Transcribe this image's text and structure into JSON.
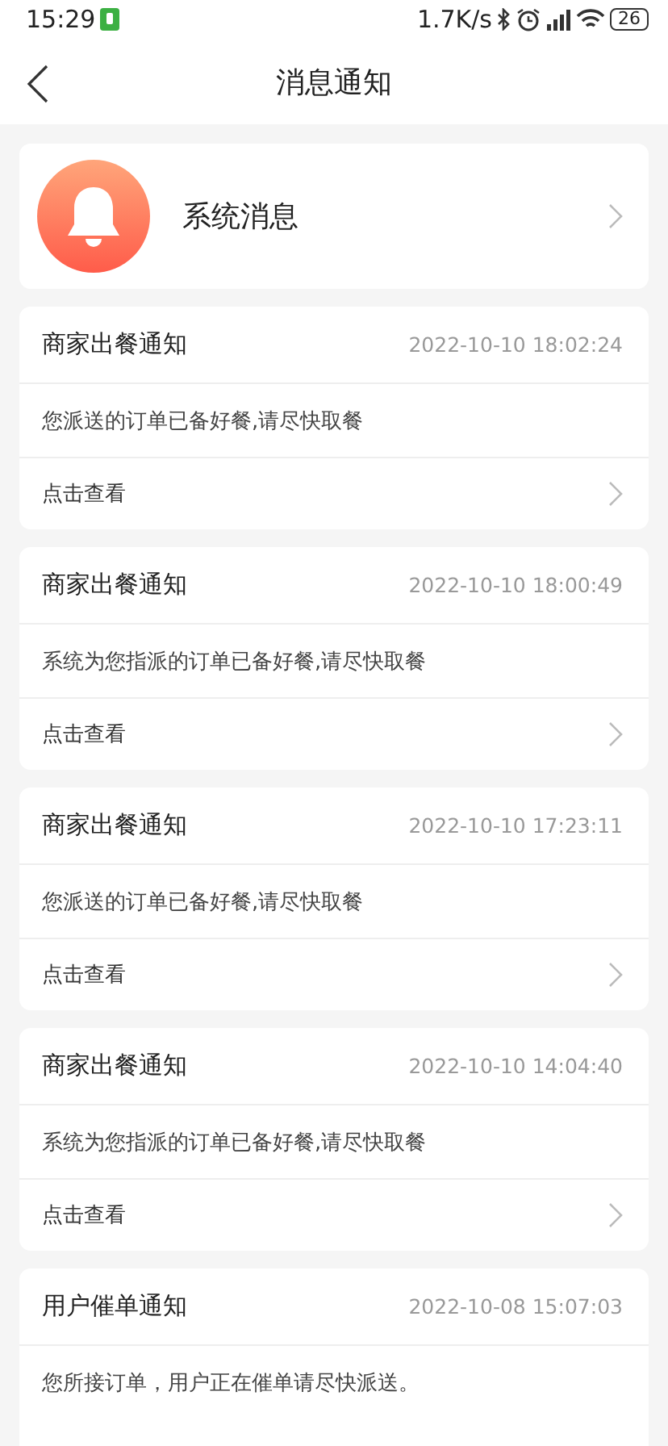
{
  "status_bar": {
    "time": "15:29",
    "speed": "1.7K/s",
    "battery": "26"
  },
  "header": {
    "title": "消息通知"
  },
  "system_entry": {
    "label": "系统消息"
  },
  "notifications": [
    {
      "title": "商家出餐通知",
      "time": "2022-10-10 18:02:24",
      "message": "您派送的订单已备好餐,请尽快取餐",
      "action": "点击查看"
    },
    {
      "title": "商家出餐通知",
      "time": "2022-10-10 18:00:49",
      "message": "系统为您指派的订单已备好餐,请尽快取餐",
      "action": "点击查看"
    },
    {
      "title": "商家出餐通知",
      "time": "2022-10-10 17:23:11",
      "message": "您派送的订单已备好餐,请尽快取餐",
      "action": "点击查看"
    },
    {
      "title": "商家出餐通知",
      "time": "2022-10-10 14:04:40",
      "message": "系统为您指派的订单已备好餐,请尽快取餐",
      "action": "点击查看"
    },
    {
      "title": "用户催单通知",
      "time": "2022-10-08 15:07:03",
      "message": "您所接订单，用户正在催单请尽快派送。"
    }
  ]
}
